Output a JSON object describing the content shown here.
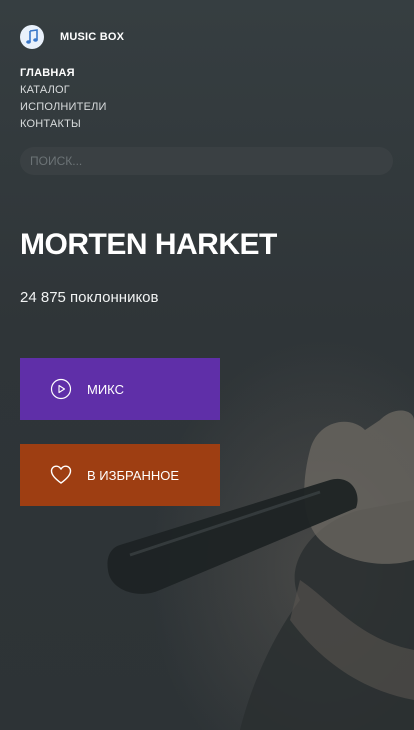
{
  "brand": {
    "name": "MUSIC BOX",
    "icon": "music-note-icon"
  },
  "nav": {
    "items": [
      "ГЛАВНАЯ",
      "КАТАЛОГ",
      "ИСПОЛНИТЕЛИ",
      "КОНТАКТЫ"
    ],
    "active": "ГЛАВНАЯ"
  },
  "search": {
    "placeholder": "ПОИСК...",
    "value": ""
  },
  "artist": {
    "name": "MORTEN HARKET",
    "fans": "24 875 поклонников"
  },
  "buttons": {
    "mix": {
      "label": "МИКС",
      "icon": "play-circle-icon",
      "color": "#5f2fa8"
    },
    "favorite": {
      "label": "В ИЗБРАННОЕ",
      "icon": "heart-icon",
      "color": "#9e3e12"
    }
  }
}
